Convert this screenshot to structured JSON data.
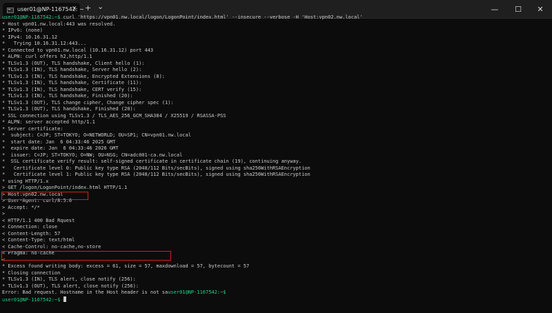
{
  "tab": {
    "title": "user01@NP-1167542: ~"
  },
  "toolbar": {
    "close": "✕",
    "new_tab": "+",
    "dropdown": "⌄"
  },
  "window": {
    "minimize": "—",
    "maximize": "☐",
    "close": "✕"
  },
  "terminal": {
    "prompt": "user01@NP-1167542:~$",
    "command": " curl 'https://vpn01.nw.local/logon/LogonPoint/index.html' --insecure --verbose -H 'Host:vpn02.nw.local'",
    "output": [
      "* Host vpn01.nw.local:443 was resolved.",
      "* IPv6: (none)",
      "* IPv4: 10.16.31.12",
      "*   Trying 10.16.31.12:443...",
      "* Connected to vpn01.nw.local (10.16.31.12) port 443",
      "* ALPN: curl offers h2,http/1.1",
      "* TLSv1.3 (OUT), TLS handshake, Client hello (1):",
      "* TLSv1.3 (IN), TLS handshake, Server hello (2):",
      "* TLSv1.3 (IN), TLS handshake, Encrypted Extensions (8):",
      "* TLSv1.3 (IN), TLS handshake, Certificate (11):",
      "* TLSv1.3 (IN), TLS handshake, CERT verify (15):",
      "* TLSv1.3 (IN), TLS handshake, Finished (20):",
      "* TLSv1.3 (OUT), TLS change cipher, Change cipher spec (1):",
      "* TLSv1.3 (OUT), TLS handshake, Finished (20):",
      "* SSL connection using TLSv1.3 / TLS_AES_256_GCM_SHA384 / X25519 / RSASSA-PSS",
      "* ALPN: server accepted http/1.1",
      "* Server certificate:",
      "*  subject: C=JP; ST=TOKYO; O=NETWORLD; OU=SP1; CN=vpn01.nw.local",
      "*  start date: Jan  6 04:33:46 2025 GMT",
      "*  expire date: Jan  6 04:33:46 2026 GMT",
      "*  issuer: C=JP; ST=TOKYO; O=NW; OU=NSG; CN=adc001-ca.nw.local",
      "*  SSL certificate verify result: self-signed certificate in certificate chain (19), continuing anyway.",
      "*   Certificate level 0: Public key type RSA (2048/112 Bits/secBits), signed using sha256WithRSAEncryption",
      "*   Certificate level 1: Public key type RSA (2048/112 Bits/secBits), signed using sha256WithRSAEncryption",
      "* using HTTP/1.x",
      "> GET /logon/LogonPoint/index.html HTTP/1.1",
      "> Host:vpn02.nw.local",
      "> User-Agent: curl/8.5.0",
      "> Accept: */*",
      ">",
      "< HTTP/1.1 400 Bad Rquest",
      "< Connection: close",
      "< Content-Length: 57",
      "< Content-Type: text/html",
      "< Cache-Control: no-cache,no-store",
      "< Pragma: no-cache",
      "<",
      "* Excess found writing body: excess = 61, size = 57, maxdownload = 57, bytecount = 57",
      "* Closing connection",
      "* TLSv1.3 (IN), TLS alert, close notify (256):",
      "* TLSv1.3 (OUT), TLS alert, close notify (256):"
    ],
    "error_text": "Error: Bad request. Hostname in the Host header is not sa",
    "error_prompt": "user01@NP-1167542:~$",
    "final_prompt": "user01@NP-1167542:~$"
  },
  "colors": {
    "background": "#0c0c0c",
    "text": "#cccccc",
    "prompt": "#23d18b",
    "highlight": "#d21f1f"
  }
}
